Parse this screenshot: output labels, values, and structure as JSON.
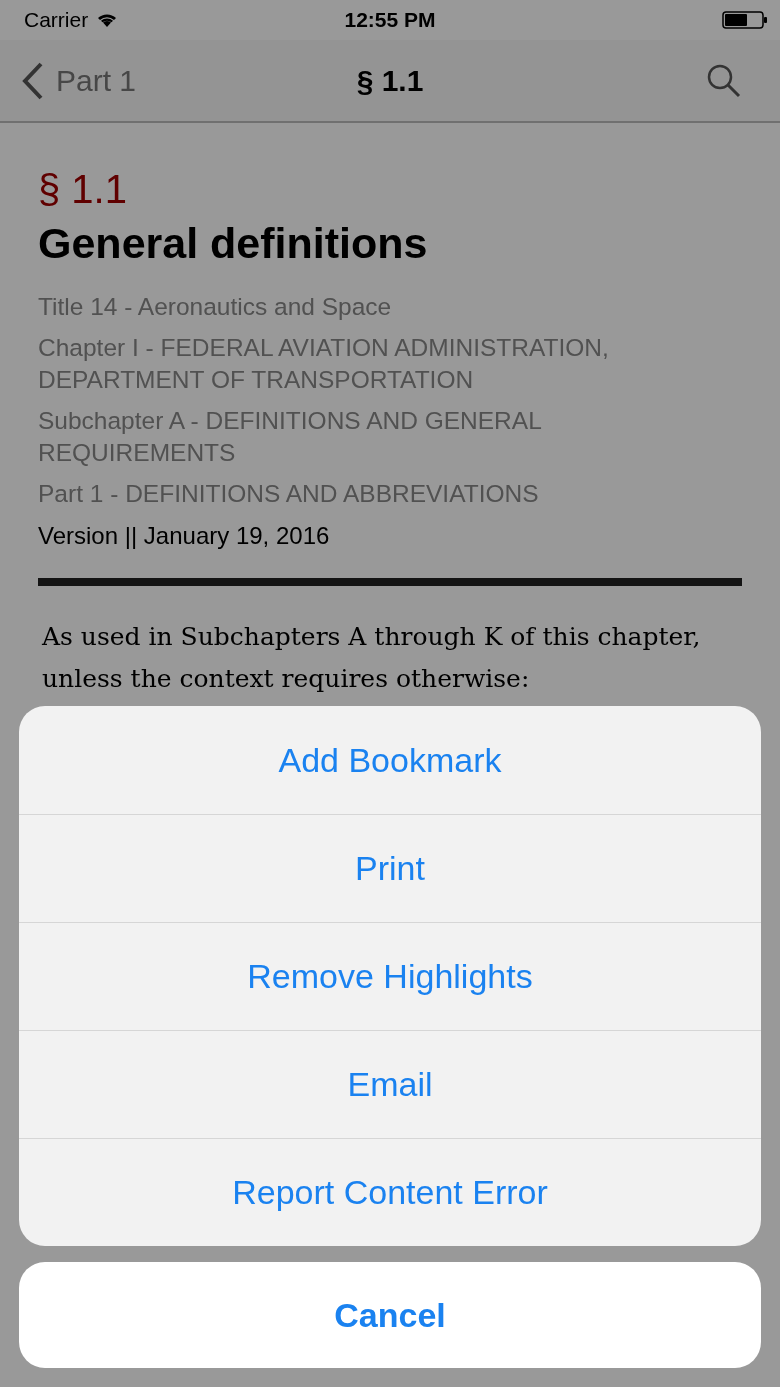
{
  "status_bar": {
    "carrier": "Carrier",
    "time": "12:55 PM"
  },
  "nav_bar": {
    "back_label": "Part 1",
    "title": "§ 1.1"
  },
  "section": {
    "number": "§ 1.1",
    "title": "General definitions",
    "hierarchy": [
      "Title 14 - Aeronautics and Space",
      "Chapter I - FEDERAL AVIATION ADMINISTRATION, DEPARTMENT OF TRANSPORTATION",
      "Subchapter A - DEFINITIONS AND GENERAL REQUIREMENTS",
      "Part 1 - DEFINITIONS AND ABBREVIATIONS"
    ],
    "version": "Version || January 19, 2016"
  },
  "body": [
    "As used in Subchapters A through K of this chapter, unless the context requires otherwise:"
  ],
  "action_sheet": {
    "actions": [
      "Add Bookmark",
      "Print",
      "Remove Highlights",
      "Email",
      "Report Content Error"
    ],
    "cancel": "Cancel"
  }
}
